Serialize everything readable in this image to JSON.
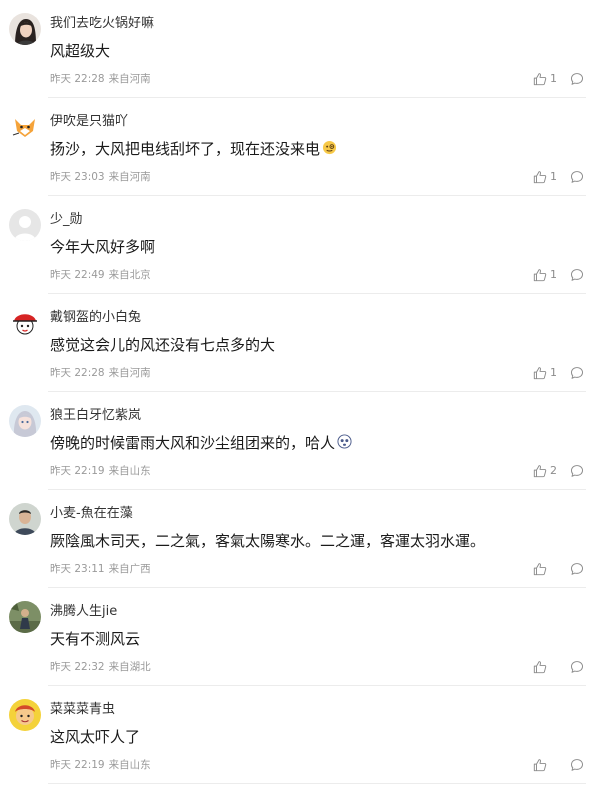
{
  "comments": [
    {
      "username": "我们去吃火锅好嘛",
      "content": "风超级大",
      "time": "昨天 22:28",
      "location": "来自河南",
      "likes": "1",
      "avatar": "woman-dark-hair-avatar"
    },
    {
      "username": "伊吹是只猫吖",
      "content": "扬沙，大风把电线刮坏了，现在还没来电",
      "emoji": "face-with-monocle-emoji",
      "time": "昨天 23:03",
      "location": "来自河南",
      "likes": "1",
      "avatar": "cartoon-fox-avatar"
    },
    {
      "username": "少_勋",
      "content": "今年大风好多啊",
      "time": "昨天 22:49",
      "location": "来自北京",
      "likes": "1",
      "avatar": "default-gray-avatar"
    },
    {
      "username": "戴钢盔的小白兔",
      "content": "感觉这会儿的风还没有七点多的大",
      "time": "昨天 22:28",
      "location": "来自河南",
      "likes": "1",
      "avatar": "red-hat-cartoon-avatar"
    },
    {
      "username": "狼王白牙忆紫岚",
      "content": "傍晚的时候雷雨大风和沙尘组团来的，哈人",
      "emoji": "scared-face-emoji",
      "time": "昨天 22:19",
      "location": "来自山东",
      "likes": "2",
      "avatar": "anime-girl-avatar"
    },
    {
      "username": "小麦-魚在在藻",
      "content": "厥陰風木司天，二之氣，客氣太陽寒水。二之運，客運太羽水運。",
      "time": "昨天 23:11",
      "location": "来自广西",
      "likes": "",
      "avatar": "man-photo-avatar"
    },
    {
      "username": "沸腾人生jie",
      "content": "天有不测风云",
      "time": "昨天 22:32",
      "location": "来自湖北",
      "likes": "",
      "avatar": "outdoor-photo-avatar"
    },
    {
      "username": "菜菜菜青虫",
      "content": "这风太吓人了",
      "time": "昨天 22:19",
      "location": "来自山东",
      "likes": "",
      "avatar": "yellow-cartoon-avatar"
    }
  ],
  "colors": {
    "text": "#1a1a1a",
    "username": "#333333",
    "meta": "#9a9a9a",
    "divider": "#ececec",
    "icon": "#8c8c8c"
  },
  "icons": {
    "like": "thumbs-up-icon",
    "reply": "comment-bubble-icon"
  }
}
